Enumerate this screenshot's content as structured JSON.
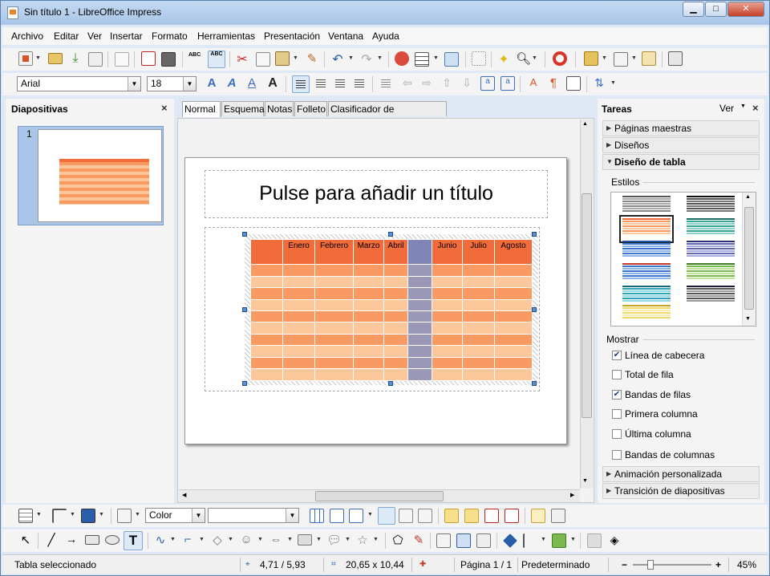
{
  "window": {
    "title": "Sin título 1 - LibreOffice Impress",
    "btn_min": "▁",
    "btn_max": "□",
    "btn_close": "✕"
  },
  "menu": [
    "Archivo",
    "Editar",
    "Ver",
    "Insertar",
    "Formato",
    "Herramientas",
    "Presentación",
    "Ventana",
    "Ayuda"
  ],
  "format": {
    "font": "Arial",
    "size": "18"
  },
  "slides_pane": {
    "title": "Diapositivas",
    "close": "×",
    "slide_number": "1"
  },
  "view_tabs": [
    "Normal",
    "Esquema",
    "Notas",
    "Folleto",
    "Clasificador de diapositivas"
  ],
  "slide": {
    "title_placeholder": "Pulse para añadir un título"
  },
  "table": {
    "headers": [
      "",
      "Enero",
      "Febrero",
      "Marzo",
      "Abril",
      "",
      "Junio",
      "Julio",
      "Agosto"
    ],
    "body_rows": 10,
    "colors": {
      "header": "#f26b3a",
      "band_dark": "#f89a62",
      "band_light": "#fcc79a",
      "selected_col": "#9b97b6",
      "selected_col_header": "#7f86b7"
    }
  },
  "tasks": {
    "title": "Tareas",
    "ver_label": "Ver",
    "close": "×",
    "sections_top": [
      "Páginas maestras",
      "Diseños",
      "Diseño de tabla"
    ],
    "estilos_label": "Estilos",
    "mostrar_label": "Mostrar",
    "options": [
      {
        "label": "Línea de cabecera",
        "checked": true
      },
      {
        "label": "Total de fila",
        "checked": false
      },
      {
        "label": "Bandas de filas",
        "checked": true
      },
      {
        "label": "Primera columna",
        "checked": false
      },
      {
        "label": "Última columna",
        "checked": false
      },
      {
        "label": "Bandas de columnas",
        "checked": false
      }
    ],
    "sections_bottom": [
      "Animación personalizada",
      "Transición de diapositivas"
    ]
  },
  "drawing_bar": {
    "color_mode": "Color",
    "color_value": ""
  },
  "status": {
    "message": "Tabla seleccionado",
    "position": "4,71 / 5,93",
    "size": "20,65 x 10,44",
    "page": "Página 1 / 1",
    "master": "Predeterminado",
    "zoom": "45%",
    "zoom_level": 0.45
  }
}
